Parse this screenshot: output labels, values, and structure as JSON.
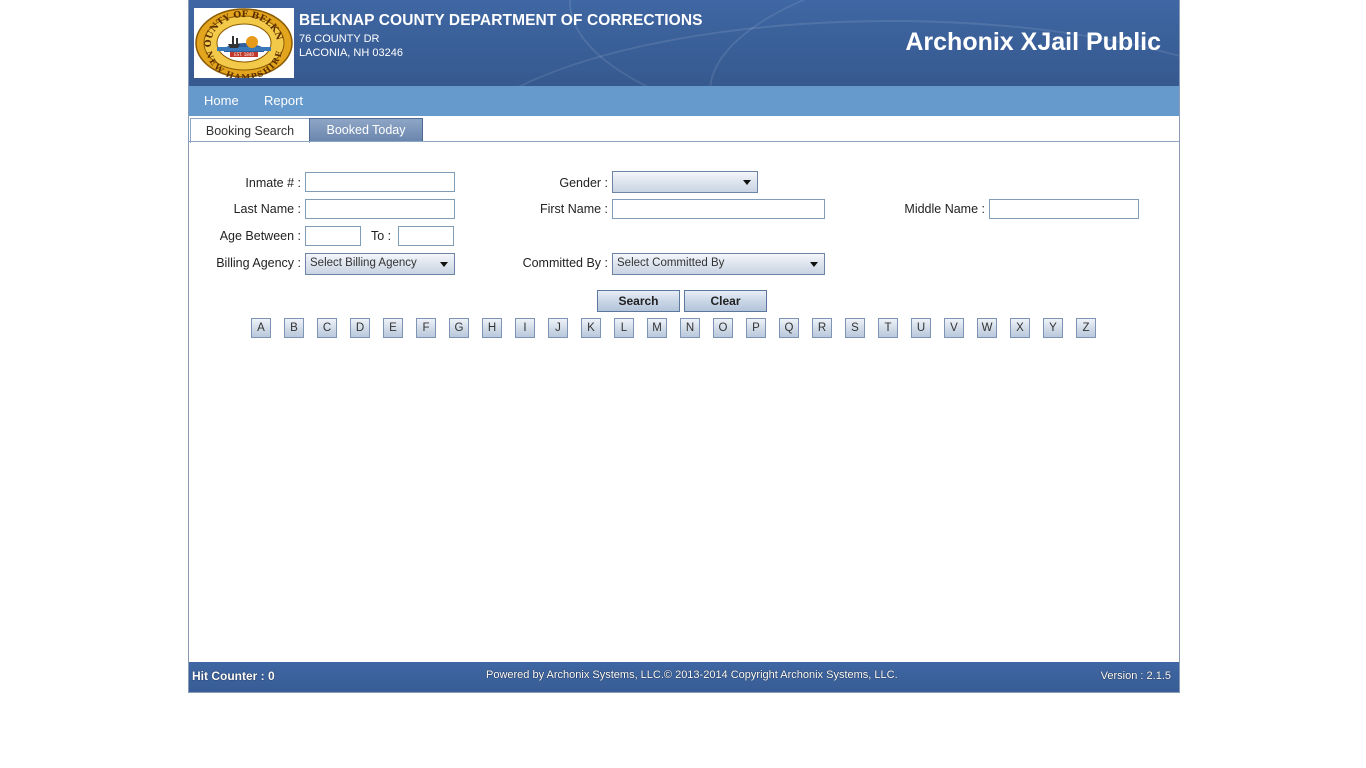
{
  "header": {
    "org_name": "BELKNAP COUNTY DEPARTMENT OF CORRECTIONS",
    "address_line1": "76 COUNTY DR",
    "address_line2": "LACONIA, NH 03246",
    "app_title": "Archonix XJail Public",
    "seal": {
      "top_text": "COUNTY OF BELKNAP",
      "bottom_text": "NEW HAMPSHIRE",
      "established": "EST. 1840"
    }
  },
  "nav": {
    "items": [
      {
        "label": "Home"
      },
      {
        "label": "Report"
      }
    ]
  },
  "tabs": {
    "active": "Booking Search",
    "other": "Booked Today"
  },
  "form": {
    "inmate_label": "Inmate # :",
    "gender_label": "Gender :",
    "gender_value": "",
    "last_name_label": "Last Name :",
    "first_name_label": "First Name :",
    "middle_name_label": "Middle Name :",
    "age_label": "Age Between :",
    "to_label": "To :",
    "billing_label": "Billing Agency :",
    "billing_value": "Select Billing Agency",
    "committed_label": "Committed By :",
    "committed_value": "Select Committed By"
  },
  "buttons": {
    "search": "Search",
    "clear": "Clear"
  },
  "letters": [
    "A",
    "B",
    "C",
    "D",
    "E",
    "F",
    "G",
    "H",
    "I",
    "J",
    "K",
    "L",
    "M",
    "N",
    "O",
    "P",
    "Q",
    "R",
    "S",
    "T",
    "U",
    "V",
    "W",
    "X",
    "Y",
    "Z"
  ],
  "footer": {
    "hit_counter": "Hit Counter : 0",
    "powered": "Powered by Archonix Systems, LLC.© 2013-2014 Copyright Archonix Systems, LLC.",
    "version": "Version : 2.1.5"
  },
  "colors": {
    "banner": "#3f67a3",
    "navbar": "#6699cc",
    "seal_gold": "#e0a520"
  }
}
